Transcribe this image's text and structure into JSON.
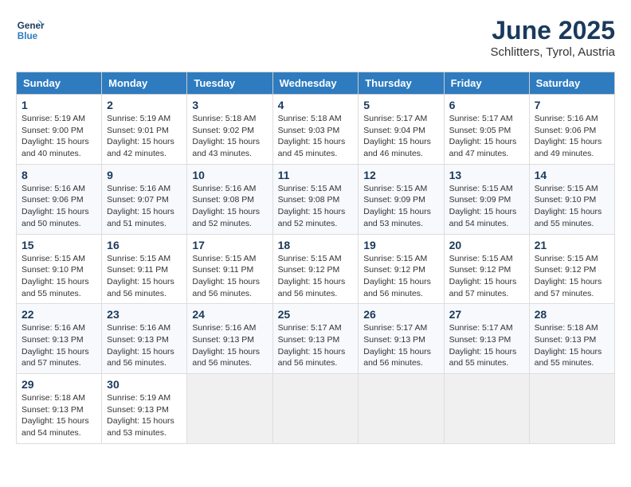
{
  "logo": {
    "line1": "General",
    "line2": "Blue"
  },
  "title": "June 2025",
  "subtitle": "Schlitters, Tyrol, Austria",
  "days_of_week": [
    "Sunday",
    "Monday",
    "Tuesday",
    "Wednesday",
    "Thursday",
    "Friday",
    "Saturday"
  ],
  "weeks": [
    [
      {
        "day": "1",
        "info": "Sunrise: 5:19 AM\nSunset: 9:00 PM\nDaylight: 15 hours\nand 40 minutes."
      },
      {
        "day": "2",
        "info": "Sunrise: 5:19 AM\nSunset: 9:01 PM\nDaylight: 15 hours\nand 42 minutes."
      },
      {
        "day": "3",
        "info": "Sunrise: 5:18 AM\nSunset: 9:02 PM\nDaylight: 15 hours\nand 43 minutes."
      },
      {
        "day": "4",
        "info": "Sunrise: 5:18 AM\nSunset: 9:03 PM\nDaylight: 15 hours\nand 45 minutes."
      },
      {
        "day": "5",
        "info": "Sunrise: 5:17 AM\nSunset: 9:04 PM\nDaylight: 15 hours\nand 46 minutes."
      },
      {
        "day": "6",
        "info": "Sunrise: 5:17 AM\nSunset: 9:05 PM\nDaylight: 15 hours\nand 47 minutes."
      },
      {
        "day": "7",
        "info": "Sunrise: 5:16 AM\nSunset: 9:06 PM\nDaylight: 15 hours\nand 49 minutes."
      }
    ],
    [
      {
        "day": "8",
        "info": "Sunrise: 5:16 AM\nSunset: 9:06 PM\nDaylight: 15 hours\nand 50 minutes."
      },
      {
        "day": "9",
        "info": "Sunrise: 5:16 AM\nSunset: 9:07 PM\nDaylight: 15 hours\nand 51 minutes."
      },
      {
        "day": "10",
        "info": "Sunrise: 5:16 AM\nSunset: 9:08 PM\nDaylight: 15 hours\nand 52 minutes."
      },
      {
        "day": "11",
        "info": "Sunrise: 5:15 AM\nSunset: 9:08 PM\nDaylight: 15 hours\nand 52 minutes."
      },
      {
        "day": "12",
        "info": "Sunrise: 5:15 AM\nSunset: 9:09 PM\nDaylight: 15 hours\nand 53 minutes."
      },
      {
        "day": "13",
        "info": "Sunrise: 5:15 AM\nSunset: 9:09 PM\nDaylight: 15 hours\nand 54 minutes."
      },
      {
        "day": "14",
        "info": "Sunrise: 5:15 AM\nSunset: 9:10 PM\nDaylight: 15 hours\nand 55 minutes."
      }
    ],
    [
      {
        "day": "15",
        "info": "Sunrise: 5:15 AM\nSunset: 9:10 PM\nDaylight: 15 hours\nand 55 minutes."
      },
      {
        "day": "16",
        "info": "Sunrise: 5:15 AM\nSunset: 9:11 PM\nDaylight: 15 hours\nand 56 minutes."
      },
      {
        "day": "17",
        "info": "Sunrise: 5:15 AM\nSunset: 9:11 PM\nDaylight: 15 hours\nand 56 minutes."
      },
      {
        "day": "18",
        "info": "Sunrise: 5:15 AM\nSunset: 9:12 PM\nDaylight: 15 hours\nand 56 minutes."
      },
      {
        "day": "19",
        "info": "Sunrise: 5:15 AM\nSunset: 9:12 PM\nDaylight: 15 hours\nand 56 minutes."
      },
      {
        "day": "20",
        "info": "Sunrise: 5:15 AM\nSunset: 9:12 PM\nDaylight: 15 hours\nand 57 minutes."
      },
      {
        "day": "21",
        "info": "Sunrise: 5:15 AM\nSunset: 9:12 PM\nDaylight: 15 hours\nand 57 minutes."
      }
    ],
    [
      {
        "day": "22",
        "info": "Sunrise: 5:16 AM\nSunset: 9:13 PM\nDaylight: 15 hours\nand 57 minutes."
      },
      {
        "day": "23",
        "info": "Sunrise: 5:16 AM\nSunset: 9:13 PM\nDaylight: 15 hours\nand 56 minutes."
      },
      {
        "day": "24",
        "info": "Sunrise: 5:16 AM\nSunset: 9:13 PM\nDaylight: 15 hours\nand 56 minutes."
      },
      {
        "day": "25",
        "info": "Sunrise: 5:17 AM\nSunset: 9:13 PM\nDaylight: 15 hours\nand 56 minutes."
      },
      {
        "day": "26",
        "info": "Sunrise: 5:17 AM\nSunset: 9:13 PM\nDaylight: 15 hours\nand 56 minutes."
      },
      {
        "day": "27",
        "info": "Sunrise: 5:17 AM\nSunset: 9:13 PM\nDaylight: 15 hours\nand 55 minutes."
      },
      {
        "day": "28",
        "info": "Sunrise: 5:18 AM\nSunset: 9:13 PM\nDaylight: 15 hours\nand 55 minutes."
      }
    ],
    [
      {
        "day": "29",
        "info": "Sunrise: 5:18 AM\nSunset: 9:13 PM\nDaylight: 15 hours\nand 54 minutes."
      },
      {
        "day": "30",
        "info": "Sunrise: 5:19 AM\nSunset: 9:13 PM\nDaylight: 15 hours\nand 53 minutes."
      },
      {
        "day": "",
        "info": ""
      },
      {
        "day": "",
        "info": ""
      },
      {
        "day": "",
        "info": ""
      },
      {
        "day": "",
        "info": ""
      },
      {
        "day": "",
        "info": ""
      }
    ]
  ]
}
